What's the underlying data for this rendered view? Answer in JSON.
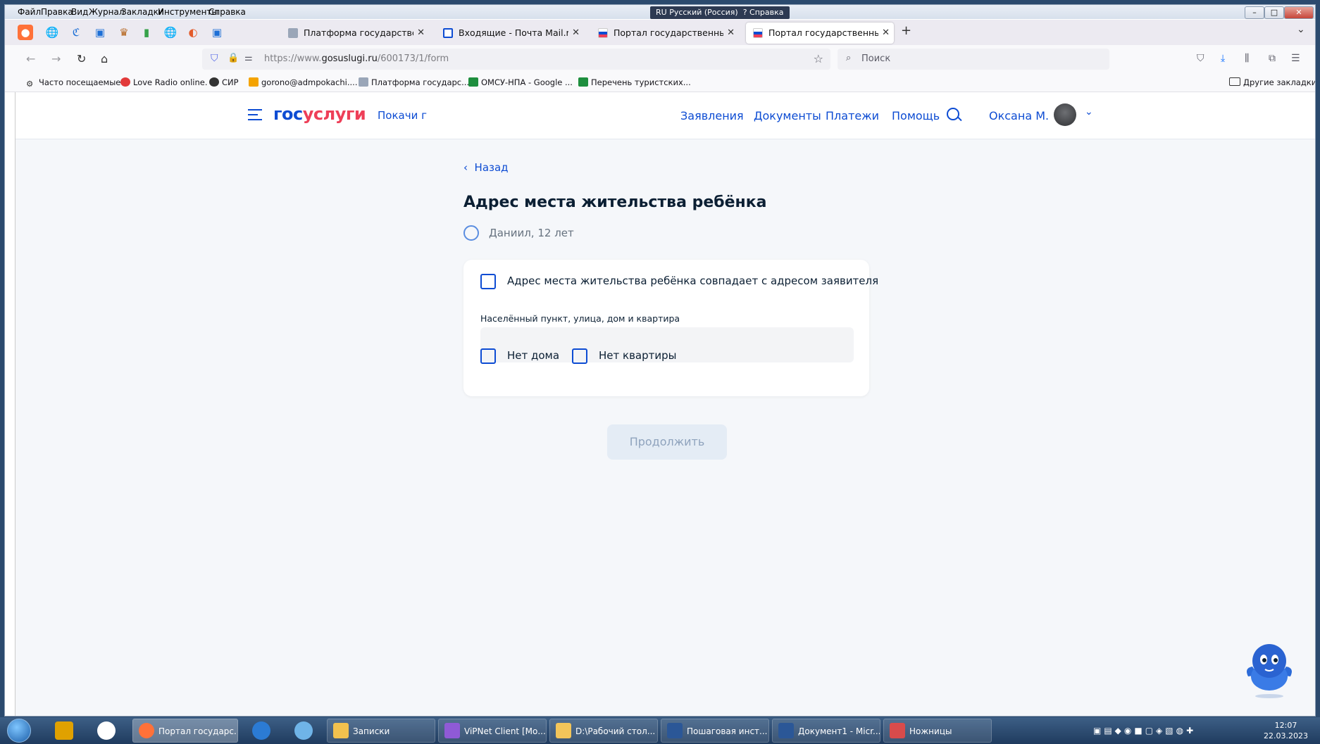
{
  "menubar": {
    "items": [
      "Файл",
      "Правка",
      "Вид",
      "Журнал",
      "Закладки",
      "Инструменты",
      "Справка"
    ]
  },
  "langbar": {
    "lang": "RU Русский (Россия)",
    "help": "Справка"
  },
  "tabs": [
    {
      "label": "Платформа государственных с"
    },
    {
      "label": "Входящие - Почта Mail.ru"
    },
    {
      "label": "Портал государственных услу"
    },
    {
      "label": "Портал государственных услу"
    }
  ],
  "url": {
    "prefix": "https://www.",
    "domain": "gosuslugi.ru",
    "path": "/600173/1/form"
  },
  "search": {
    "placeholder": "Поиск"
  },
  "bookmarks": [
    "Часто посещаемые",
    "Love Radio online.",
    "СИР",
    "gorono@admpokachi....",
    "Платформа государс...",
    "ОМСУ-НПА - Google ...",
    "Перечень туристских..."
  ],
  "other_bookmarks": "Другие закладки",
  "site": {
    "logo_part1": "гос",
    "logo_part2": "услуги",
    "region": "Покачи г",
    "nav": [
      "Заявления",
      "Документы",
      "Платежи",
      "Помощь"
    ],
    "user": "Оксана М."
  },
  "form": {
    "back": "Назад",
    "title": "Адрес места жительства ребёнка",
    "child": "Даниил, 12 лет",
    "same_address": "Адрес места жительства ребёнка совпадает с адресом заявителя",
    "address_label": "Населённый пункт, улица, дом и квартира",
    "address_value": "",
    "no_house": "Нет дома",
    "no_flat": "Нет квартиры",
    "continue": "Продолжить"
  },
  "taskbar": {
    "items": [
      "Портал государс...",
      "Записки",
      "ViPNet Client [Мо...",
      "D:\\Рабочий стол...",
      "Пошаговая инст...",
      "Документ1 - Micr...",
      "Ножницы"
    ],
    "time": "12:07",
    "date": "22.03.2023"
  }
}
